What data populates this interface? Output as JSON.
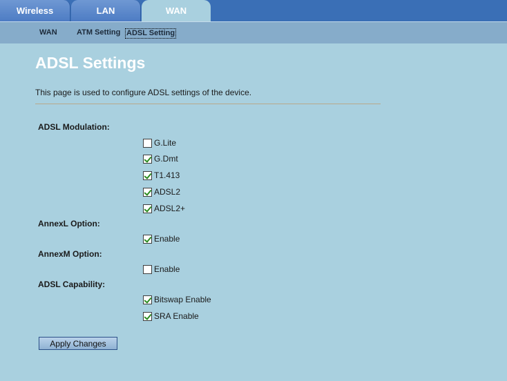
{
  "tabs": {
    "wireless": "Wireless",
    "lan": "LAN",
    "wan": "WAN"
  },
  "subnav": {
    "wan": "WAN",
    "atm": "ATM Setting",
    "adsl": "ADSL Setting"
  },
  "page": {
    "title": "ADSL Settings",
    "description": "This page is used to configure ADSL settings of the device."
  },
  "sections": {
    "modulation": {
      "label": "ADSL Modulation:",
      "options": [
        {
          "label": "G.Lite",
          "checked": false
        },
        {
          "label": "G.Dmt",
          "checked": true
        },
        {
          "label": "T1.413",
          "checked": true
        },
        {
          "label": "ADSL2",
          "checked": true
        },
        {
          "label": "ADSL2+",
          "checked": true
        }
      ]
    },
    "annexl": {
      "label": "AnnexL Option:",
      "options": [
        {
          "label": "Enable",
          "checked": true
        }
      ]
    },
    "annexm": {
      "label": "AnnexM Option:",
      "options": [
        {
          "label": "Enable",
          "checked": false
        }
      ]
    },
    "capability": {
      "label": "ADSL Capability:",
      "options": [
        {
          "label": "Bitswap Enable",
          "checked": true
        },
        {
          "label": "SRA Enable",
          "checked": true
        }
      ]
    }
  },
  "apply_label": "Apply Changes",
  "colors": {
    "background": "#a9d0df",
    "topbar": "#3a6fb6",
    "subbar": "#86acca",
    "check": "#2a8b1e"
  }
}
